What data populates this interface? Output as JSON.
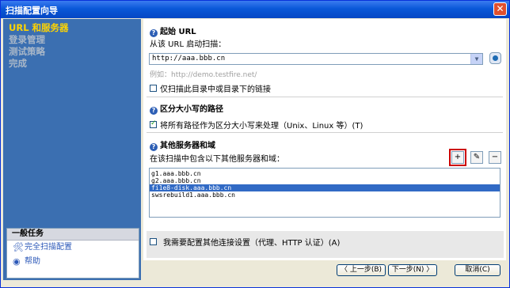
{
  "window": {
    "title": "扫描配置向导",
    "close": "✕"
  },
  "nav": [
    {
      "label": "URL 和服务器",
      "active": true
    },
    {
      "label": "登录管理",
      "active": false
    },
    {
      "label": "测试策略",
      "active": false
    },
    {
      "label": "完成",
      "active": false
    }
  ],
  "tasks": {
    "header": "一般任务",
    "items": [
      {
        "label": "完全扫描配置",
        "icon": "tools-icon"
      },
      {
        "label": "帮助",
        "icon": "help-icon"
      }
    ]
  },
  "start": {
    "heading": "起始 URL",
    "label": "从该 URL 启动扫描：",
    "url": "http://aaa.bbb.cn",
    "example": "例如：http://demo.testfire.net/",
    "only_dir_check": {
      "label": "仅扫描此目录中或目录下的链接",
      "checked": false
    }
  },
  "case": {
    "heading": "区分大小写的路径",
    "check": {
      "label": "将所有路径作为区分大小写来处理（Unix、Linux 等）(T)",
      "checked": true
    }
  },
  "servers": {
    "heading": "其他服务器和域",
    "label": "在该扫描中包含以下其他服务器和域：",
    "add": "+",
    "edit": "✎",
    "remove": "−",
    "items": [
      "g1.aaa.bbb.cn",
      "g2.aaa.bbb.cn",
      "fi1e8-disk.aaa.bbb.cn",
      "swsrebuild1.aaa.bbb.cn"
    ],
    "selected_index": 2
  },
  "proxy": {
    "label": "我需要配置其他连接设置（代理、HTTP 认证）(A)",
    "checked": false
  },
  "buttons": {
    "prev": "〈 上一步(B)",
    "next": "下一步(N) 〉",
    "cancel": "取消(C)"
  }
}
